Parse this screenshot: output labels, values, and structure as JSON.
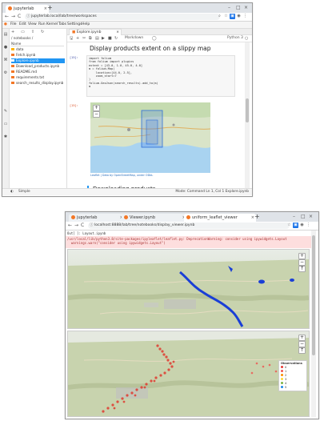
{
  "top_window": {
    "tabs": [
      {
        "label": "jupyterlab",
        "active": true
      }
    ],
    "url": "jupyterlab.local/lab/tree/workspaces",
    "menu": [
      "File",
      "Edit",
      "View",
      "Run",
      "Kernel",
      "Tabs",
      "Settings",
      "Help"
    ],
    "file_browser": {
      "path": "/ notebooks /",
      "column_header": "Name",
      "items": [
        {
          "name": "data",
          "type": "folder",
          "selected": false
        },
        {
          "name": "Fetch.ipynb",
          "type": "notebook",
          "selected": false
        },
        {
          "name": "Explore.ipynb",
          "type": "notebook",
          "selected": true
        },
        {
          "name": "Download_products.ipynb",
          "type": "notebook",
          "selected": false
        },
        {
          "name": "README.md",
          "type": "file",
          "selected": false
        },
        {
          "name": "requirements.txt",
          "type": "file",
          "selected": false
        },
        {
          "name": "search_results_display.ipynb",
          "type": "file",
          "selected": false
        }
      ]
    },
    "notebook_tab": "Explore.ipynb",
    "kernel": "Python 3",
    "cell_type": "Markdown",
    "heading": "Display products extent on a slippy map",
    "code_prompt": "[15]:",
    "code_lines": [
      "import folium",
      "from folium import plugins",
      "",
      "extent = [43.0, 1.0, 45.0, 4.0]",
      "m = folium.Map(",
      "    location=[44.0, 2.5],",
      "    zoom_start=7",
      ")",
      "folium.GeoJson(search_results).add_to(m)",
      "m"
    ],
    "out_prompt": "[15]:",
    "map_caption": "Leaflet | Data by OpenStreetMap, under ODbL",
    "section_heading": "Downloading products",
    "status_left": "Simple",
    "status_right": "Mode: Command   Ln 1, Col 1   Explore.ipynb"
  },
  "bottom_window": {
    "tabs": [
      {
        "label": "jupyterlab",
        "active": false
      },
      {
        "label": "Viewer.ipynb",
        "active": false
      },
      {
        "label": "uniform_leaflet_viewer",
        "active": true
      }
    ],
    "url": "localhost:8888/lab/tree/notebooks/display_viewer.ipynb",
    "out_prompt": "Out[ ]: Layout.ipynb",
    "warning_lines": [
      "/usr/local/lib/python3.8/site-packages/ipyleaflet/leaflet.py: DeprecationWarning: consider using ipywidgets.Layout",
      "  warnings.warn(\"consider using ipywidgets.Layout\")"
    ],
    "legend": {
      "title": "Observations",
      "items": [
        {
          "label": "0",
          "color": "#e53935"
        },
        {
          "label": "1",
          "color": "#ef5350"
        },
        {
          "label": "2",
          "color": "#fb8c00"
        },
        {
          "label": "3",
          "color": "#fdd835"
        },
        {
          "label": "4",
          "color": "#7cb342"
        },
        {
          "label": "5",
          "color": "#1e88e5"
        }
      ]
    }
  },
  "colors": {
    "accent": "#2196f3",
    "orange": "#f37726",
    "warning_bg": "#fddede",
    "route_blue": "#1a3fd6",
    "points_red": "#e03a2f"
  }
}
